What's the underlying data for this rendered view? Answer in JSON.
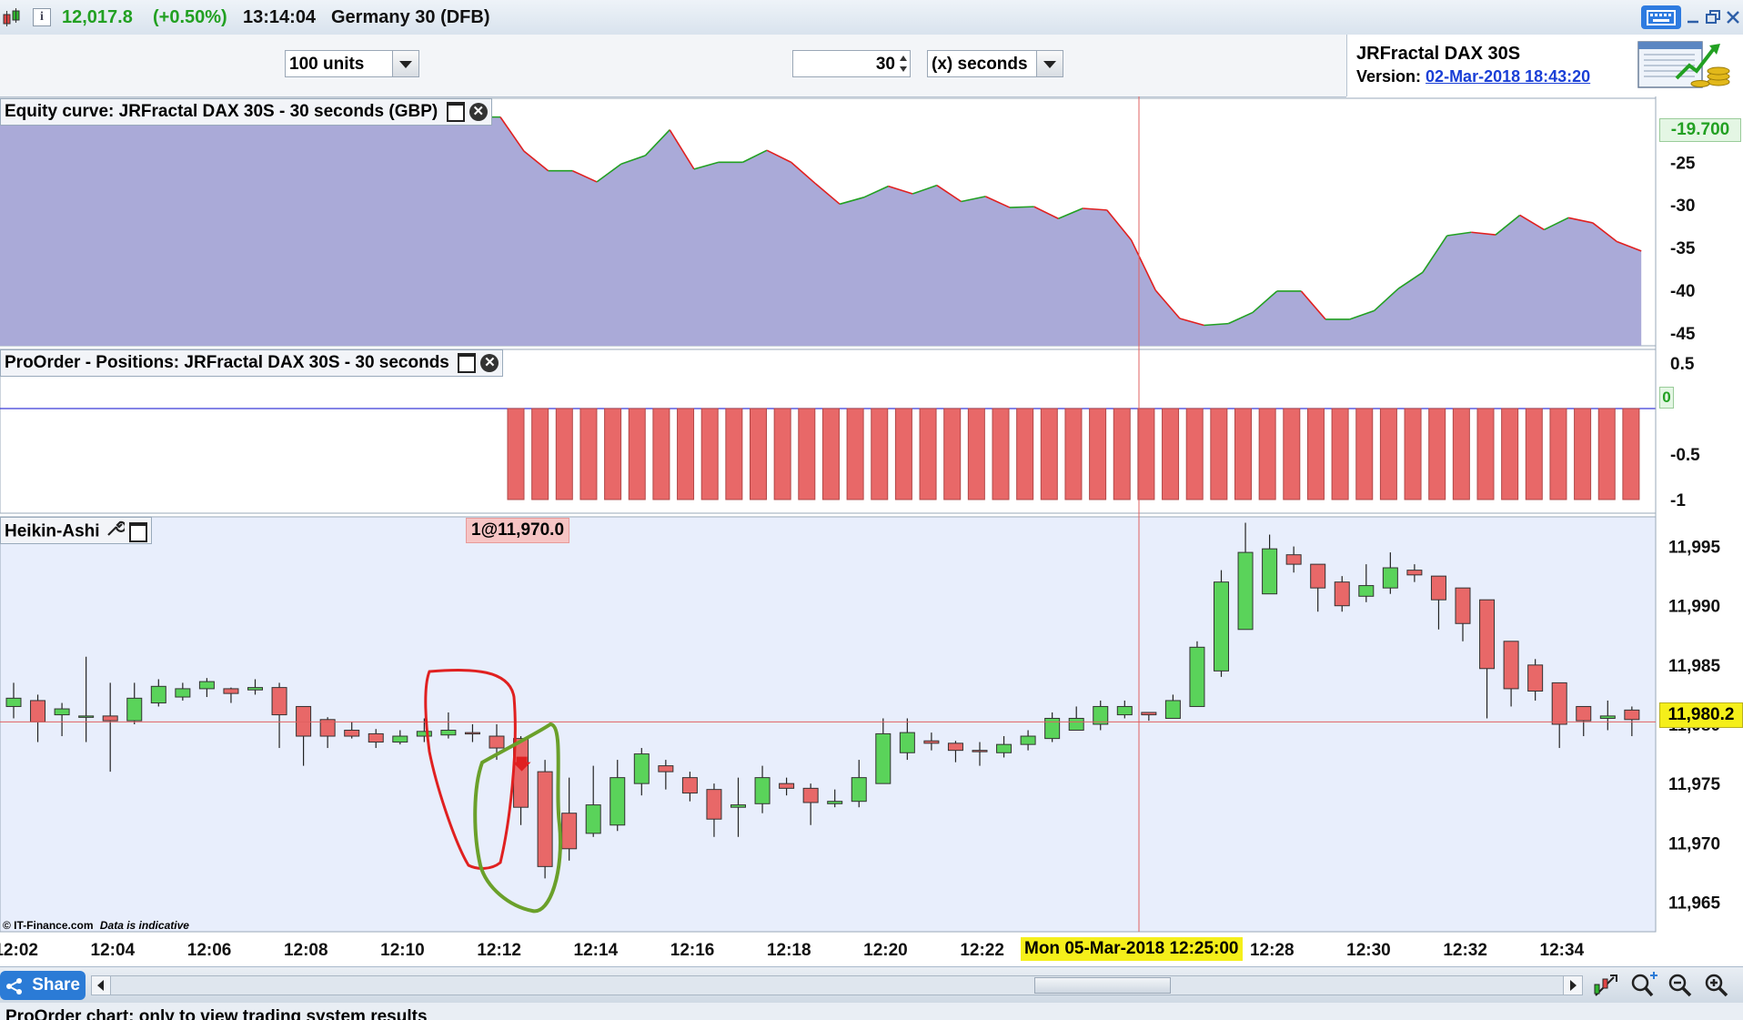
{
  "header": {
    "price": "12,017.8",
    "change": "(+0.50%)",
    "time": "13:14:04",
    "instrument": "Germany 30 (DFB)",
    "info_icon": "i"
  },
  "toolbar": {
    "units_value": "100 units",
    "period_value": "30",
    "period_unit": "(x) seconds"
  },
  "system_info": {
    "name": "JRFractal DAX 30S",
    "version_label": "Version:",
    "version_value": "02-Mar-2018 18:43:20"
  },
  "panels": {
    "equity_title": "Equity curve: JRFractal DAX 30S - 30 seconds (GBP)",
    "positions_title": "ProOrder - Positions: JRFractal DAX 30S - 30 seconds",
    "price_title": "Heikin-Ashi",
    "order_label": "1@11,970.0",
    "credit": "© IT-Finance.com",
    "credit_note": "Data is indicative"
  },
  "crosshair": {
    "date_label": "Mon 05-Mar-2018 12:25:00",
    "price_label": "11,980.2",
    "equity_label": "-19.700",
    "position_label": "0"
  },
  "bottom": {
    "share_label": "Share",
    "footer_text": "ProOrder chart: only to view trading system results"
  },
  "colors": {
    "up": "#5ad35a",
    "down": "#e86868",
    "equity_fill": "#aaaad8",
    "price_bg": "#e8eefc",
    "accent_green": "#22a022",
    "highlight": "#f5ef1a"
  },
  "chart_data": [
    {
      "type": "area",
      "title": "Equity curve: JRFractal DAX 30S - 30 seconds (GBP)",
      "ylim": [
        -46.5,
        -17.5
      ],
      "y_ticks": [
        "-25",
        "-30",
        "-35",
        "-40",
        "-45"
      ],
      "equity_start_value": -19.7,
      "values": [
        -23.7,
        -26.0,
        -26.0,
        -27.3,
        -25.2,
        -24.2,
        -21.2,
        -25.8,
        -25.0,
        -25.0,
        -23.6,
        -25.0,
        -27.5,
        -29.9,
        -29.1,
        -27.8,
        -28.7,
        -27.7,
        -29.6,
        -29.0,
        -30.3,
        -30.2,
        -31.6,
        -30.4,
        -30.6,
        -34.1,
        -40.0,
        -43.3,
        -44.1,
        -43.9,
        -42.6,
        -40.1,
        -40.1,
        -43.4,
        -43.4,
        -42.4,
        -39.8,
        -37.9,
        -33.6,
        -33.2,
        -33.5,
        -31.2,
        -32.9,
        -31.5,
        -32.1,
        -34.3,
        -35.4
      ]
    },
    {
      "type": "bar",
      "title": "ProOrder - Positions: JRFractal DAX 30S - 30 seconds",
      "ylim": [
        -1.15,
        0.65
      ],
      "y_ticks": [
        "0.5",
        "-0.5",
        "-1"
      ],
      "flat_bars_before_short": 21,
      "short_bars": 48,
      "short_value": -1
    },
    {
      "type": "candlestick",
      "title": "Heikin-Ashi",
      "ylim": [
        11962.5,
        11997.5
      ],
      "y_ticks": [
        "11,995",
        "11,990",
        "11,985",
        "11,980",
        "11,975",
        "11,970",
        "11,965"
      ],
      "x_ticks": [
        "12:02",
        "12:04",
        "12:06",
        "12:08",
        "12:10",
        "12:12",
        "12:14",
        "12:16",
        "12:18",
        "12:20",
        "12:22",
        "12:28",
        "12:30",
        "12:32",
        "12:34"
      ],
      "candles": [
        [
          11981.5,
          11982.2,
          11983.5,
          11980.5
        ],
        [
          11982.0,
          11980.2,
          11982.5,
          11978.5
        ],
        [
          11980.8,
          11981.3,
          11981.8,
          11979.0
        ],
        [
          11980.6,
          11980.7,
          11985.7,
          11978.5
        ],
        [
          11980.7,
          11980.3,
          11983.5,
          11976.0
        ],
        [
          11980.3,
          11982.2,
          11983.5,
          11980.0
        ],
        [
          11981.8,
          11983.2,
          11983.8,
          11981.5
        ],
        [
          11982.3,
          11983.0,
          11983.5,
          11982.0
        ],
        [
          11983.0,
          11983.6,
          11983.9,
          11982.3
        ],
        [
          11983.0,
          11982.6,
          11983.1,
          11981.8
        ],
        [
          11982.9,
          11983.1,
          11983.8,
          11982.5
        ],
        [
          11983.1,
          11980.8,
          11983.5,
          11978.0
        ],
        [
          11981.5,
          11979.0,
          11981.5,
          11976.5
        ],
        [
          11980.4,
          11979.0,
          11980.6,
          11978.0
        ],
        [
          11979.5,
          11979.0,
          11980.2,
          11978.8
        ],
        [
          11979.2,
          11978.5,
          11979.6,
          11978.0
        ],
        [
          11978.5,
          11979.0,
          11979.5,
          11978.3
        ],
        [
          11979.0,
          11979.4,
          11980.5,
          11978.5
        ],
        [
          11979.1,
          11979.5,
          11981.0,
          11978.8
        ],
        [
          11979.3,
          11979.2,
          11980.0,
          11978.5
        ],
        [
          11979.0,
          11978.0,
          11980.0,
          11977.0
        ],
        [
          11978.8,
          11973.0,
          11979.0,
          11971.5
        ],
        [
          11976.0,
          11968.0,
          11977.0,
          11967.0
        ],
        [
          11972.5,
          11969.5,
          11975.5,
          11968.5
        ],
        [
          11970.8,
          11973.2,
          11976.5,
          11970.5
        ],
        [
          11971.5,
          11975.5,
          11977.0,
          11971.0
        ],
        [
          11975.0,
          11977.5,
          11978.0,
          11974.0
        ],
        [
          11976.5,
          11976.0,
          11977.0,
          11974.5
        ],
        [
          11975.5,
          11974.2,
          11976.0,
          11973.5
        ],
        [
          11974.5,
          11972.0,
          11975.0,
          11970.5
        ],
        [
          11973.0,
          11973.2,
          11975.5,
          11970.5
        ],
        [
          11973.3,
          11975.5,
          11976.5,
          11972.5
        ],
        [
          11975.0,
          11974.6,
          11975.5,
          11974.0
        ],
        [
          11974.6,
          11973.4,
          11975.0,
          11971.5
        ],
        [
          11973.3,
          11973.5,
          11974.5,
          11973.0
        ],
        [
          11973.5,
          11975.5,
          11977.0,
          11973.0
        ],
        [
          11975.0,
          11979.2,
          11980.5,
          11975.0
        ],
        [
          11977.6,
          11979.3,
          11980.5,
          11977.0
        ],
        [
          11978.6,
          11978.4,
          11979.3,
          11977.8
        ],
        [
          11978.4,
          11977.8,
          11978.6,
          11976.8
        ],
        [
          11977.8,
          11977.7,
          11978.5,
          11976.5
        ],
        [
          11977.6,
          11978.3,
          11979.0,
          11977.2
        ],
        [
          11978.3,
          11979.0,
          11979.5,
          11977.8
        ],
        [
          11978.8,
          11980.5,
          11981.0,
          11978.5
        ],
        [
          11979.5,
          11980.5,
          11981.5,
          11979.5
        ],
        [
          11980.0,
          11981.5,
          11982.0,
          11979.5
        ],
        [
          11980.8,
          11981.5,
          11982.0,
          11980.5
        ],
        [
          11981.0,
          11980.8,
          11981.0,
          11980.3
        ],
        [
          11980.5,
          11982.0,
          11982.5,
          11980.5
        ],
        [
          11981.5,
          11986.5,
          11987.0,
          11981.5
        ],
        [
          11984.5,
          11992.0,
          11993.0,
          11984.0
        ],
        [
          11988.0,
          11994.5,
          11997.0,
          11988.0
        ],
        [
          11991.0,
          11994.8,
          11996.0,
          11991.0
        ],
        [
          11994.3,
          11993.5,
          11995.0,
          11992.8
        ],
        [
          11993.5,
          11991.5,
          11993.5,
          11989.5
        ],
        [
          11992.0,
          11990.0,
          11992.5,
          11989.5
        ],
        [
          11990.8,
          11991.7,
          11993.5,
          11990.3
        ],
        [
          11991.5,
          11993.2,
          11994.5,
          11991.0
        ],
        [
          11993.0,
          11992.6,
          11993.5,
          11992.0
        ],
        [
          11992.5,
          11990.5,
          11992.5,
          11988.0
        ],
        [
          11991.5,
          11988.5,
          11991.5,
          11987.0
        ],
        [
          11990.5,
          11984.7,
          11990.5,
          11980.5
        ],
        [
          11987.0,
          11983.0,
          11987.0,
          11981.5
        ],
        [
          11985.0,
          11982.8,
          11985.5,
          11982.0
        ],
        [
          11983.5,
          11980.0,
          11983.5,
          11978.0
        ],
        [
          11981.5,
          11980.3,
          11981.5,
          11979.0
        ],
        [
          11980.5,
          11980.7,
          11982.0,
          11979.5
        ],
        [
          11981.2,
          11980.4,
          11981.5,
          11979.0
        ],
        [
          11980.6,
          11981.8,
          11983.5,
          11980.5
        ],
        [
          11981.0,
          11984.5,
          11989.0,
          11980.5
        ]
      ]
    }
  ]
}
